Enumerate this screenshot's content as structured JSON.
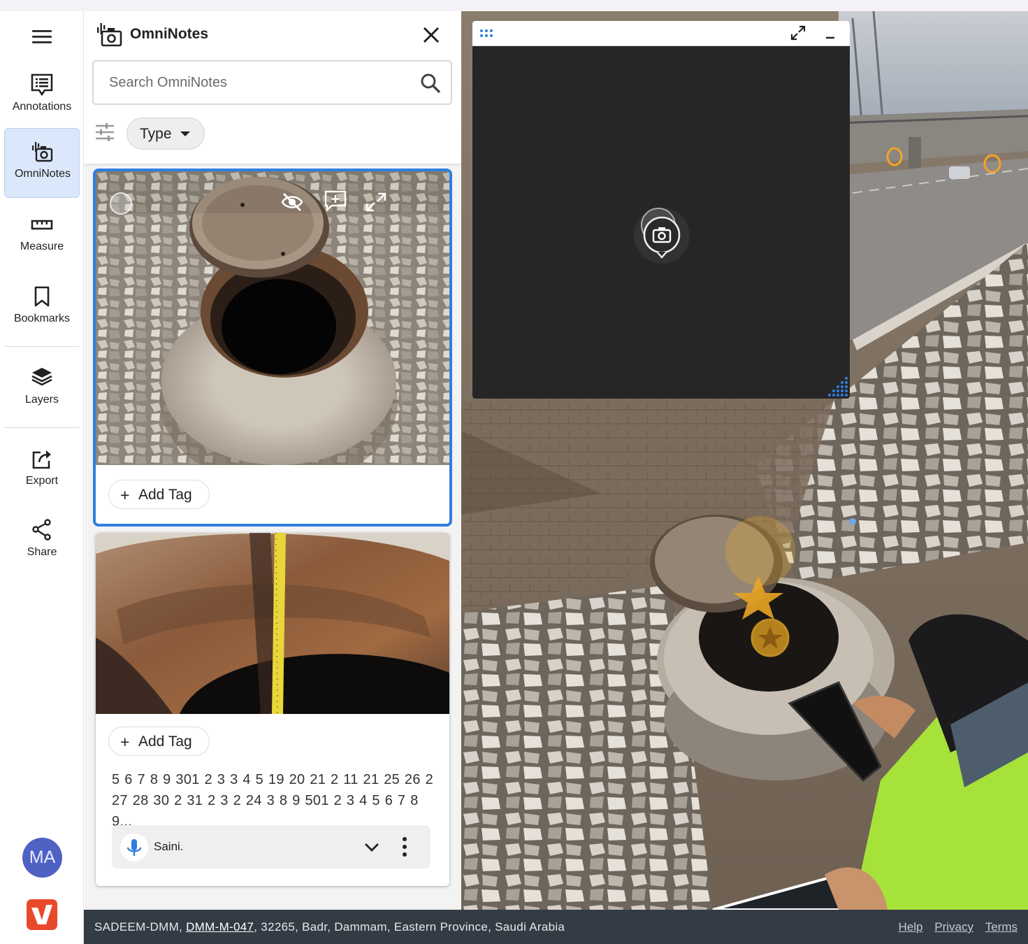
{
  "nav": {
    "menu_icon": "hamburger-icon",
    "items": [
      {
        "label": "Annotations",
        "icon": "annotations-icon"
      },
      {
        "label": "OmniNotes",
        "icon": "omninotes-camera-icon",
        "active": true
      },
      {
        "label": "Measure",
        "icon": "ruler-icon"
      },
      {
        "label": "Bookmarks",
        "icon": "bookmark-icon"
      },
      {
        "label": "Layers",
        "icon": "layers-icon"
      },
      {
        "label": "Export",
        "icon": "export-icon"
      },
      {
        "label": "Share",
        "icon": "share-icon"
      }
    ],
    "avatar_initials": "MA",
    "accent": "#2f7fe0",
    "active_bg": "#dbe7fb"
  },
  "panel": {
    "title": "OmniNotes",
    "search": {
      "placeholder": "Search OmniNotes",
      "value": ""
    },
    "filter_label": "Type",
    "notes": [
      {
        "selected": true,
        "photo": "open manhole with lid on gravel",
        "overlay_icons": [
          "hide-eye-icon",
          "add-comment-icon",
          "expand-icon"
        ],
        "add_tag_label": "Add Tag"
      },
      {
        "selected": false,
        "photo": "measuring tape inside manhole",
        "add_tag_label": "Add Tag",
        "transcript": "5 6 7 8 9 301 2 3 3 4 5 19 20 21 2 11 21 25 26 2 27 28 30 2 31 2 3 2 24 3 8 9 501 2 3 4 5 6 7 8 9...",
        "audio_author": "Saini."
      }
    ]
  },
  "viewer": {
    "mini_map": {
      "background": "#262626",
      "marker_icon": "camera-marker-icon"
    }
  },
  "footer": {
    "location_prefix": "SADEEM-DMM, ",
    "location_link": "DMM-M-047",
    "location_suffix": ", 32265, Badr, Dammam, Eastern Province, Saudi Arabia",
    "links": [
      "Help",
      "Privacy",
      "Terms"
    ],
    "background": "#333b45"
  }
}
